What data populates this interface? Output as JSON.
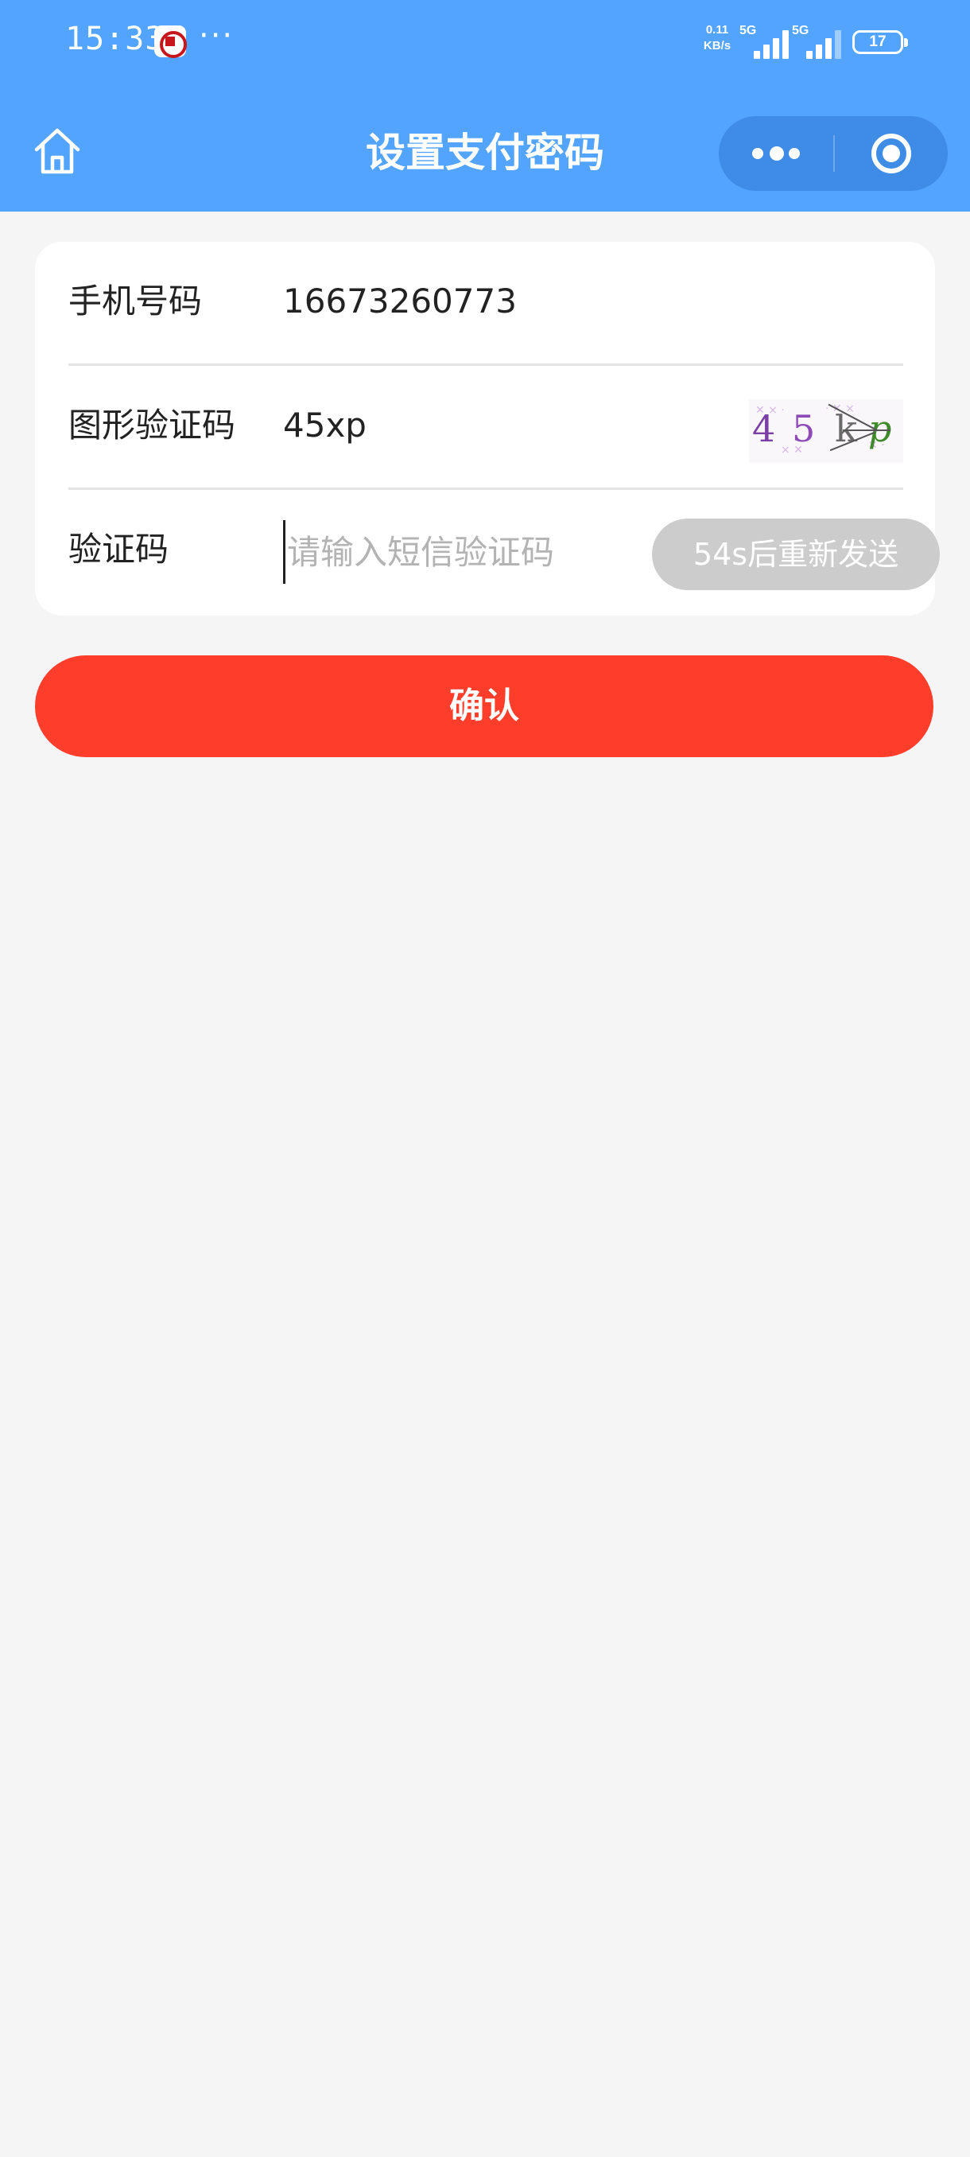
{
  "status_bar": {
    "time": "15:33",
    "app_icon": "bank-app-icon",
    "more_dots": "···",
    "net_speed_value": "0.11",
    "net_speed_unit": "KB/s",
    "sim1_network": "5G",
    "sim2_network": "5G",
    "battery_level": "17"
  },
  "nav": {
    "home_icon": "home-icon",
    "title": "设置支付密码",
    "more_icon": "more-dots-icon",
    "close_icon": "target-close-icon"
  },
  "form": {
    "phone": {
      "label": "手机号码",
      "value": "16673260773"
    },
    "captcha": {
      "label": "图形验证码",
      "value": "45xp",
      "image_chars": [
        "4",
        "5",
        "k",
        "p"
      ],
      "image_char_colors": [
        "#7b3fa6",
        "#8e4bb8",
        "#6a6a6a",
        "#3f8a2a"
      ]
    },
    "sms": {
      "label": "验证码",
      "value": "",
      "placeholder": "请输入短信验证码",
      "resend_label": "54s后重新发送"
    }
  },
  "confirm_label": "确认",
  "colors": {
    "header": "#52a4ff",
    "confirm": "#ff3d2b",
    "resend_disabled": "#cccccc",
    "background": "#f5f5f5"
  }
}
